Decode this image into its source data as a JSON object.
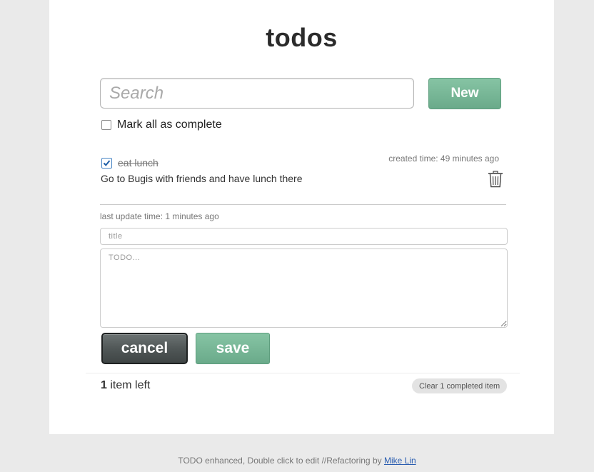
{
  "app": {
    "title": "todos"
  },
  "search": {
    "placeholder": "Search",
    "value": ""
  },
  "toolbar": {
    "new_label": "New"
  },
  "mark_all": {
    "label": "Mark all as complete",
    "checked": false
  },
  "todo": {
    "title": "eat lunch",
    "completed": true,
    "created_time": "created time: 49 minutes ago",
    "description": "Go to Bugis with friends and have lunch there"
  },
  "editor": {
    "last_update": "last update time: 1 minutes ago",
    "title_placeholder": "title",
    "text_placeholder": "TODO...",
    "cancel_label": "cancel",
    "save_label": "save"
  },
  "footer": {
    "count": "1",
    "count_suffix": " item left",
    "clear_label": "Clear 1 completed item"
  },
  "page_footer": {
    "text": "TODO enhanced, Double click to edit //Refactoring by ",
    "link_label": "Mike Lin"
  },
  "colors": {
    "accent_green": "#78b898",
    "dark_button": "#505757",
    "link": "#2a5db0"
  }
}
